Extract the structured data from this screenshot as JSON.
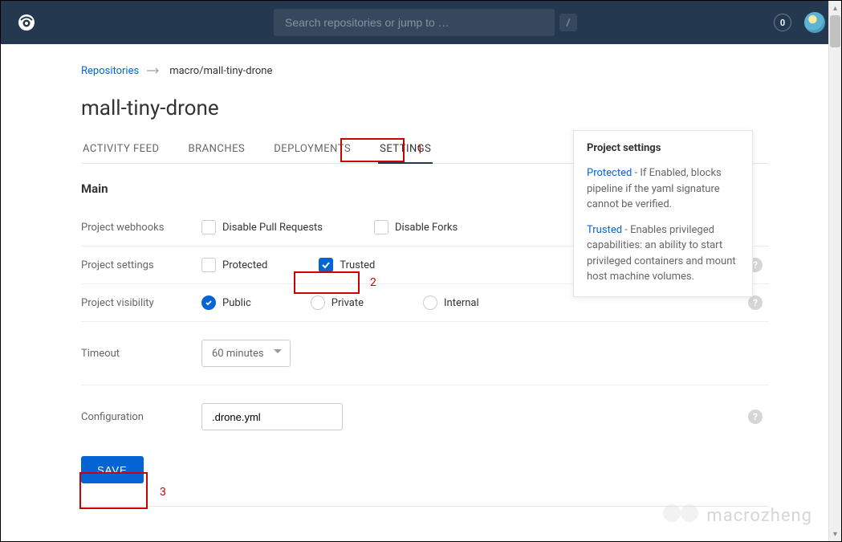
{
  "topbar": {
    "search_placeholder": "Search repositories or jump to …",
    "search_key": "/",
    "badge_count": "0"
  },
  "breadcrumbs": {
    "root": "Repositories",
    "current": "macro/mall-tiny-drone"
  },
  "page_title": "mall-tiny-drone",
  "tabs": {
    "activity": "ACTIVITY FEED",
    "branches": "BRANCHES",
    "deployments": "DEPLOYMENTS",
    "settings": "SETTINGS"
  },
  "annotations": {
    "one": "1",
    "two": "2",
    "three": "3"
  },
  "section": {
    "main": "Main"
  },
  "form": {
    "webhooks": {
      "label": "Project webhooks",
      "disable_pr": "Disable Pull Requests",
      "disable_forks": "Disable Forks"
    },
    "settings": {
      "label": "Project settings",
      "protected": "Protected",
      "trusted": "Trusted"
    },
    "visibility": {
      "label": "Project visibility",
      "public": "Public",
      "private": "Private",
      "internal": "Internal"
    },
    "timeout": {
      "label": "Timeout",
      "value": "60 minutes"
    },
    "configuration": {
      "label": "Configuration",
      "value": ".drone.yml"
    },
    "save": "SAVE"
  },
  "tooltip": {
    "title": "Project settings",
    "protected_label": "Protected",
    "protected_text": " - If Enabled, blocks pipeline if the yaml signature cannot be verified.",
    "trusted_label": "Trusted",
    "trusted_text": " - Enables privileged capabilities: an ability to start privileged containers and mount host machine volumes."
  },
  "watermark": "macrozheng"
}
